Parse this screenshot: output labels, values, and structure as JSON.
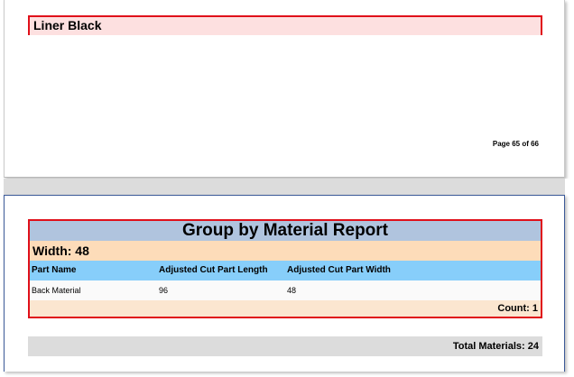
{
  "page_top": {
    "group_header": "Liner Black",
    "page_number": "Page 65 of 66"
  },
  "report": {
    "title": "Group by Material Report",
    "group_label": "Width: 48",
    "columns": [
      "Part Name",
      "Adjusted Cut Part Length",
      "Adjusted Cut Part Width"
    ],
    "rows": [
      [
        "Back Material",
        "96",
        "48"
      ]
    ],
    "count": "Count: 1",
    "total": "Total Materials: 24"
  },
  "colors": {
    "group_border": "#e0101a",
    "title_band": "#b0c4de",
    "group_band": "#fddcb9",
    "header_band": "#87cefa",
    "count_band": "#fbe6d0",
    "total_band": "#dcdcdc",
    "liner_band": "#fde0e0"
  }
}
